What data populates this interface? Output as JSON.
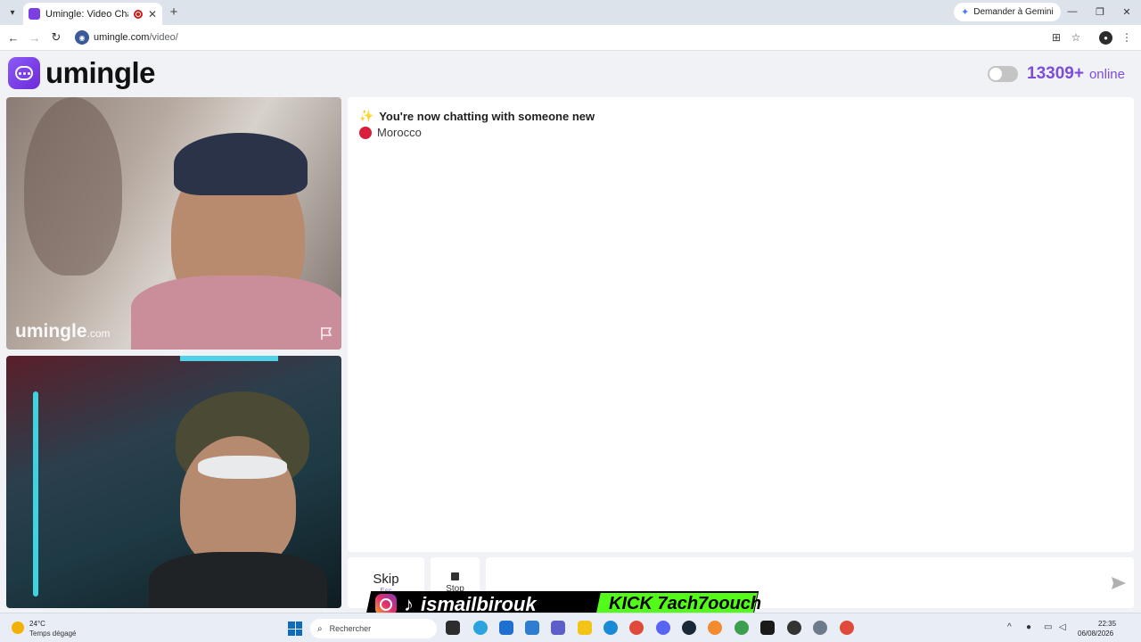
{
  "browser": {
    "tab_title": "Umingle: Video Chat with St",
    "tab_close": "✕",
    "new_tab": "+",
    "gemini_label": "Demander à Gemini",
    "url_host": "umingle.com",
    "url_path": "/video/",
    "window_controls": [
      "—",
      "❐",
      "✕"
    ]
  },
  "header": {
    "logo_text": "umingle",
    "online_count": "13309+",
    "online_label": "online",
    "toggle_on": false
  },
  "video": {
    "watermark": "umingle",
    "watermark_domain": ".com"
  },
  "chat": {
    "status_message": "You're now chatting with someone new",
    "country": "Morocco",
    "input_placeholder": ""
  },
  "controls": {
    "skip_label": "Skip",
    "skip_key": "Esc",
    "stop_label": "Stop"
  },
  "overlay": {
    "tiktok_glyph": "♪",
    "handle": "ismailbirouk",
    "kick_text": "KICK 7ach7oouch"
  },
  "taskbar": {
    "temperature": "24°C",
    "weather": "Temps dégagé",
    "search_placeholder": "Rechercher",
    "time": "22:35",
    "date": "06/08/2026"
  },
  "colors": {
    "brand": "#7c4ddb",
    "country_flag": "#d81e3b",
    "kick_green": "#53fc18"
  }
}
